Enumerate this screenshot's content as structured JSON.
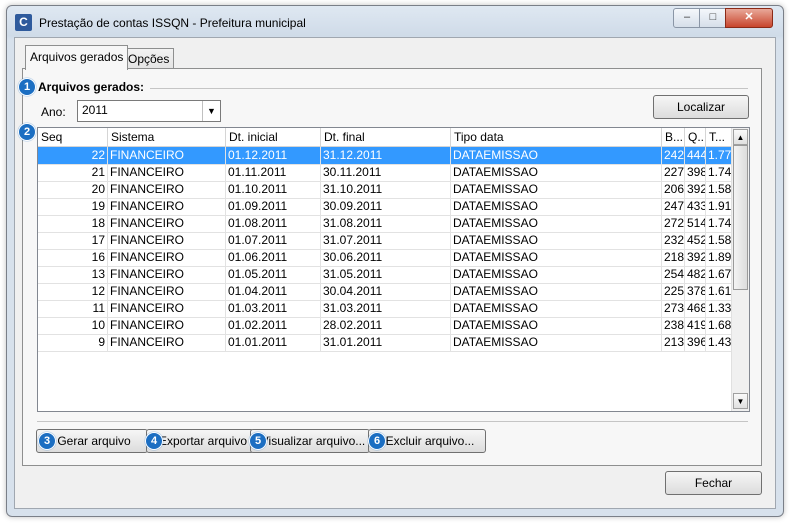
{
  "window": {
    "title": "Prestação de contas ISSQN - Prefeitura municipal",
    "icon_letter": "C",
    "minimize_glyph": "–",
    "maximize_glyph": "□",
    "close_glyph": "✕"
  },
  "tabs": [
    {
      "label": "Arquivos gerados",
      "active": true
    },
    {
      "label": "Opções",
      "active": false
    }
  ],
  "section": {
    "title": "Arquivos gerados:"
  },
  "filter": {
    "ano_label": "Ano:",
    "ano_value": "2011",
    "dropdown_glyph": "▼",
    "localizar_label": "Localizar"
  },
  "badges": [
    "1",
    "2",
    "3",
    "4",
    "5",
    "6"
  ],
  "table": {
    "columns": [
      "Seq",
      "Sistema",
      "Dt. inicial",
      "Dt. final",
      "Tipo data",
      "B...",
      "Q...",
      "T..."
    ],
    "rows": [
      [
        "22",
        "FINANCEIRO",
        "01.12.2011",
        "31.12.2011",
        "DATAEMISSAO",
        "242",
        "444",
        "1.77"
      ],
      [
        "21",
        "FINANCEIRO",
        "01.11.2011",
        "30.11.2011",
        "DATAEMISSAO",
        "227",
        "398",
        "1.74"
      ],
      [
        "20",
        "FINANCEIRO",
        "01.10.2011",
        "31.10.2011",
        "DATAEMISSAO",
        "206",
        "392",
        "1.58"
      ],
      [
        "19",
        "FINANCEIRO",
        "01.09.2011",
        "30.09.2011",
        "DATAEMISSAO",
        "247",
        "433",
        "1.91"
      ],
      [
        "18",
        "FINANCEIRO",
        "01.08.2011",
        "31.08.2011",
        "DATAEMISSAO",
        "272",
        "514",
        "1.74"
      ],
      [
        "17",
        "FINANCEIRO",
        "01.07.2011",
        "31.07.2011",
        "DATAEMISSAO",
        "232",
        "452",
        "1.58"
      ],
      [
        "16",
        "FINANCEIRO",
        "01.06.2011",
        "30.06.2011",
        "DATAEMISSAO",
        "218",
        "392",
        "1.89"
      ],
      [
        "13",
        "FINANCEIRO",
        "01.05.2011",
        "31.05.2011",
        "DATAEMISSAO",
        "254",
        "482",
        "1.67"
      ],
      [
        "12",
        "FINANCEIRO",
        "01.04.2011",
        "30.04.2011",
        "DATAEMISSAO",
        "225",
        "378",
        "1.61"
      ],
      [
        "11",
        "FINANCEIRO",
        "01.03.2011",
        "31.03.2011",
        "DATAEMISSAO",
        "273",
        "468",
        "1.33"
      ],
      [
        "10",
        "FINANCEIRO",
        "01.02.2011",
        "28.02.2011",
        "DATAEMISSAO",
        "238",
        "419",
        "1.68"
      ],
      [
        "9",
        "FINANCEIRO",
        "01.01.2011",
        "31.01.2011",
        "DATAEMISSAO",
        "213",
        "396",
        "1.43"
      ]
    ],
    "selected_row": 0,
    "scroll_up_glyph": "▲",
    "scroll_down_glyph": "▼"
  },
  "actions": {
    "gerar": "Gerar arquivo",
    "exportar": "Exportar arquivo",
    "visualizar": "Visualizar arquivo...",
    "excluir": "Excluir arquivo..."
  },
  "footer": {
    "fechar": "Fechar"
  },
  "colors": {
    "selection": "#3399ff",
    "badge": "#1b6ec2"
  }
}
